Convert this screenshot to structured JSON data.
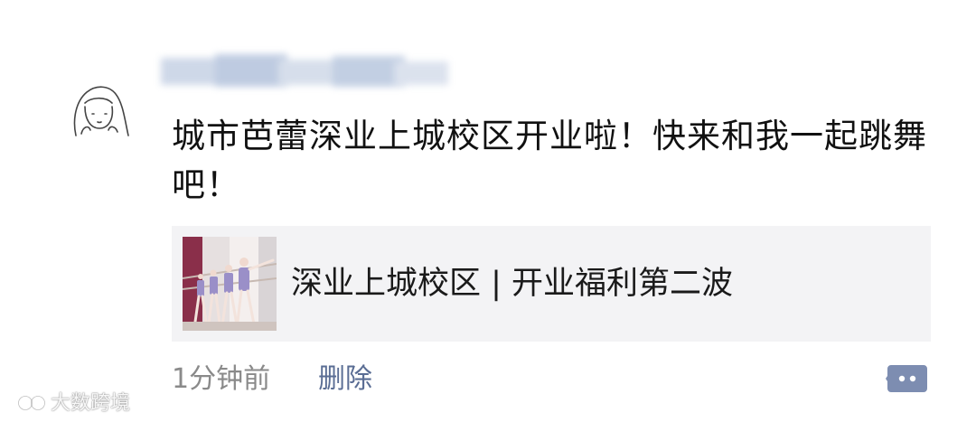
{
  "post": {
    "text": "城市芭蕾深业上城校区开业啦！快来和我一起跳舞吧！",
    "link": {
      "title": "深业上城校区 | 开业福利第二波",
      "thumbnail_icon": "ballet-class-photo"
    },
    "time": "1分钟前",
    "delete_label": "删除",
    "comment_icon": "comment-icon"
  },
  "avatar_icon": "hand-drawn-girl-avatar",
  "watermark": {
    "text": "大数跨境",
    "logo_icon": "watermark-logo-icon"
  },
  "colors": {
    "link_blue": "#5a6d94",
    "card_bg": "#f3f3f5",
    "meta_gray": "#8a8a8a"
  }
}
